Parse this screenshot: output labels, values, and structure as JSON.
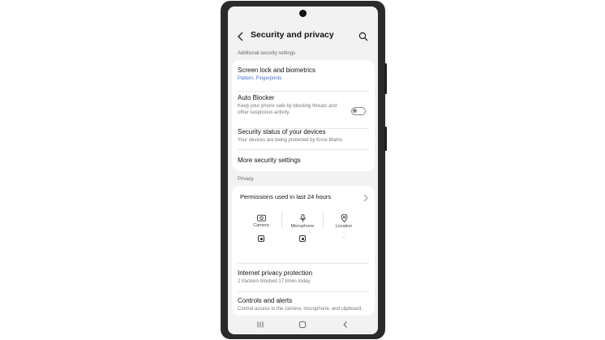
{
  "header": {
    "title": "Security and privacy"
  },
  "security": {
    "section_label": "Additional security settings",
    "items": [
      {
        "title": "Screen lock and biometrics",
        "subtitle": "Pattern, Fingerprints"
      },
      {
        "title": "Auto Blocker",
        "subtitle": "Keep your phone safe by blocking threats and other suspicious activity.",
        "toggle_on": false
      },
      {
        "title": "Security status of your devices",
        "subtitle": "Your devices are being protected by Knox Matrix."
      },
      {
        "title": "More security settings"
      }
    ]
  },
  "privacy": {
    "section_label": "Privacy",
    "permissions": {
      "title": "Permissions used in last 24 hours",
      "columns": [
        {
          "label": "Camera",
          "icon": "camera-icon",
          "status": ""
        },
        {
          "label": "Microphone",
          "icon": "microphone-icon",
          "status": ""
        },
        {
          "label": "Location",
          "icon": "location-icon",
          "status": "-"
        }
      ]
    },
    "items": [
      {
        "title": "Internet privacy protection",
        "subtitle": "2 trackers blocked 17 times today"
      },
      {
        "title": "Controls and alerts",
        "subtitle": "Control access to the camera, microphone, and clipboard."
      }
    ]
  },
  "colors": {
    "accent_blue": "#3f6fd6",
    "screen_bg": "#f2f2f2",
    "card_bg": "#ffffff",
    "frame": "#2b2b2b"
  }
}
